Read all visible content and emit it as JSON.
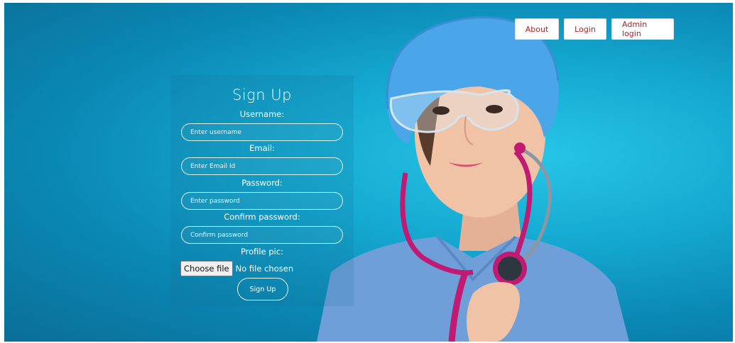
{
  "nav": {
    "about": "About",
    "login": "Login",
    "admin_login": "Admin login"
  },
  "form": {
    "title": "Sign Up",
    "username_label": "Username:",
    "username_placeholder": "Enter username",
    "email_label": "Email:",
    "email_placeholder": "Enter Email Id",
    "password_label": "Password:",
    "password_placeholder": "Enter password",
    "confirm_label": "Confirm password:",
    "confirm_placeholder": "Confirm password",
    "pic_label": "Profile pic:",
    "file_button": "Choose file",
    "file_status": "No file chosen",
    "submit": "Sign Up"
  },
  "colors": {
    "background": "#14a7cf",
    "nav_text": "#a2262e"
  }
}
